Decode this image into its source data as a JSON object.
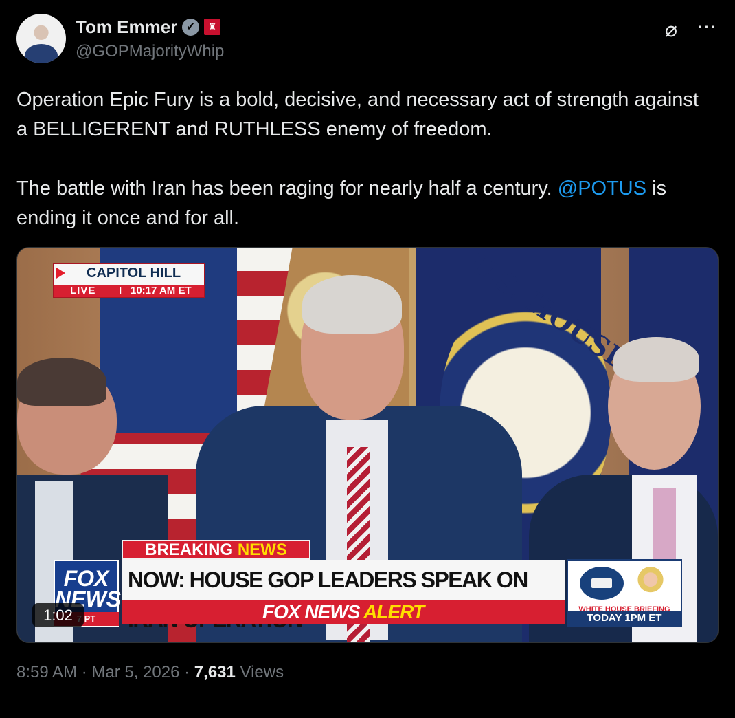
{
  "author": {
    "name": "Tom Emmer",
    "handle": "@GOPMajorityWhip"
  },
  "icons": {
    "verified": "verified-badge-icon",
    "government": "government-badge-icon",
    "grok": "grok-icon",
    "more": "more-icon"
  },
  "tweet": {
    "paragraph_1": "Operation Epic Fury is a bold, decisive, and necessary act of strength against a BELLIGERENT and RUTHLESS enemy of freedom.",
    "paragraph_2_before": "The battle with Iran has been raging for nearly half a century. ",
    "mention": "@POTUS",
    "paragraph_2_after": " is ending it once and for all."
  },
  "media": {
    "duration": "1:02",
    "overlay": {
      "location": "CAPITOL HILL",
      "live": "LIVE",
      "separator": "I",
      "time": "10:17 AM ET",
      "breaking_part_1": "BREAKING ",
      "breaking_part_2": "NEWS",
      "headline": "NOW: HOUSE GOP LEADERS SPEAK ON IRAN OPERATION",
      "alert_part_1": "FOX NEWS ",
      "alert_part_2": "ALERT",
      "logo_line_1": "FOX",
      "logo_line_2": "NEWS",
      "logo_bottom": "7 PT",
      "briefing_label": "WHITE HOUSE BRIEFING",
      "briefing_time": "TODAY 1PM ET",
      "house_seal_text": "U.S. HOUSE"
    }
  },
  "meta": {
    "time": "8:59 AM",
    "separator_1": " · ",
    "date": "Mar 5, 2026",
    "separator_2": " · ",
    "views_count": "7,631",
    "views_label": " Views"
  },
  "colors": {
    "background": "#000000",
    "primary_text": "#e7e9ea",
    "secondary_text": "#71767b",
    "link": "#1d9bf0",
    "fox_red": "#d71f31",
    "fox_blue": "#173e8e"
  }
}
